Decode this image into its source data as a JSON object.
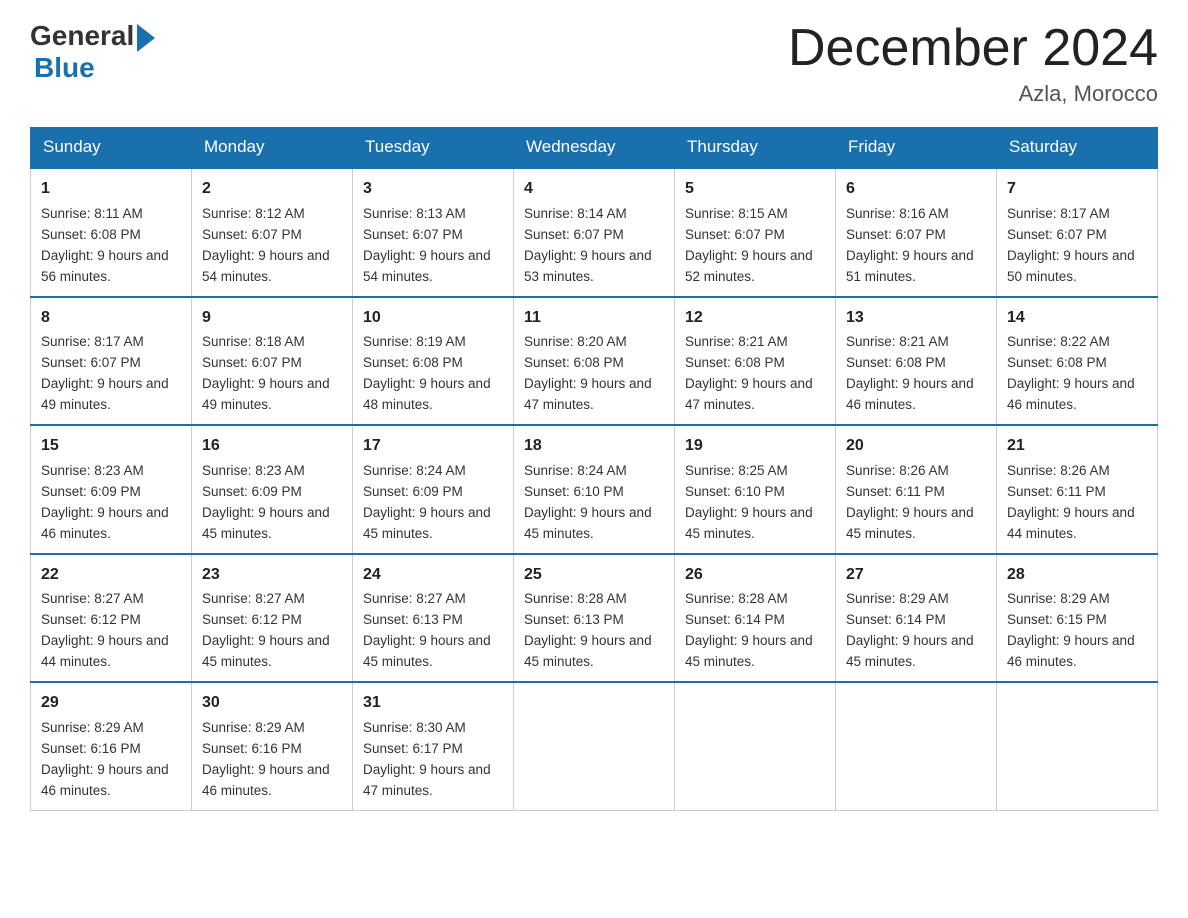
{
  "logo": {
    "general": "General",
    "blue": "Blue"
  },
  "title": "December 2024",
  "location": "Azla, Morocco",
  "days_of_week": [
    "Sunday",
    "Monday",
    "Tuesday",
    "Wednesday",
    "Thursday",
    "Friday",
    "Saturday"
  ],
  "weeks": [
    [
      {
        "day": "1",
        "sunrise": "8:11 AM",
        "sunset": "6:08 PM",
        "daylight": "9 hours and 56 minutes."
      },
      {
        "day": "2",
        "sunrise": "8:12 AM",
        "sunset": "6:07 PM",
        "daylight": "9 hours and 54 minutes."
      },
      {
        "day": "3",
        "sunrise": "8:13 AM",
        "sunset": "6:07 PM",
        "daylight": "9 hours and 54 minutes."
      },
      {
        "day": "4",
        "sunrise": "8:14 AM",
        "sunset": "6:07 PM",
        "daylight": "9 hours and 53 minutes."
      },
      {
        "day": "5",
        "sunrise": "8:15 AM",
        "sunset": "6:07 PM",
        "daylight": "9 hours and 52 minutes."
      },
      {
        "day": "6",
        "sunrise": "8:16 AM",
        "sunset": "6:07 PM",
        "daylight": "9 hours and 51 minutes."
      },
      {
        "day": "7",
        "sunrise": "8:17 AM",
        "sunset": "6:07 PM",
        "daylight": "9 hours and 50 minutes."
      }
    ],
    [
      {
        "day": "8",
        "sunrise": "8:17 AM",
        "sunset": "6:07 PM",
        "daylight": "9 hours and 49 minutes."
      },
      {
        "day": "9",
        "sunrise": "8:18 AM",
        "sunset": "6:07 PM",
        "daylight": "9 hours and 49 minutes."
      },
      {
        "day": "10",
        "sunrise": "8:19 AM",
        "sunset": "6:08 PM",
        "daylight": "9 hours and 48 minutes."
      },
      {
        "day": "11",
        "sunrise": "8:20 AM",
        "sunset": "6:08 PM",
        "daylight": "9 hours and 47 minutes."
      },
      {
        "day": "12",
        "sunrise": "8:21 AM",
        "sunset": "6:08 PM",
        "daylight": "9 hours and 47 minutes."
      },
      {
        "day": "13",
        "sunrise": "8:21 AM",
        "sunset": "6:08 PM",
        "daylight": "9 hours and 46 minutes."
      },
      {
        "day": "14",
        "sunrise": "8:22 AM",
        "sunset": "6:08 PM",
        "daylight": "9 hours and 46 minutes."
      }
    ],
    [
      {
        "day": "15",
        "sunrise": "8:23 AM",
        "sunset": "6:09 PM",
        "daylight": "9 hours and 46 minutes."
      },
      {
        "day": "16",
        "sunrise": "8:23 AM",
        "sunset": "6:09 PM",
        "daylight": "9 hours and 45 minutes."
      },
      {
        "day": "17",
        "sunrise": "8:24 AM",
        "sunset": "6:09 PM",
        "daylight": "9 hours and 45 minutes."
      },
      {
        "day": "18",
        "sunrise": "8:24 AM",
        "sunset": "6:10 PM",
        "daylight": "9 hours and 45 minutes."
      },
      {
        "day": "19",
        "sunrise": "8:25 AM",
        "sunset": "6:10 PM",
        "daylight": "9 hours and 45 minutes."
      },
      {
        "day": "20",
        "sunrise": "8:26 AM",
        "sunset": "6:11 PM",
        "daylight": "9 hours and 45 minutes."
      },
      {
        "day": "21",
        "sunrise": "8:26 AM",
        "sunset": "6:11 PM",
        "daylight": "9 hours and 44 minutes."
      }
    ],
    [
      {
        "day": "22",
        "sunrise": "8:27 AM",
        "sunset": "6:12 PM",
        "daylight": "9 hours and 44 minutes."
      },
      {
        "day": "23",
        "sunrise": "8:27 AM",
        "sunset": "6:12 PM",
        "daylight": "9 hours and 45 minutes."
      },
      {
        "day": "24",
        "sunrise": "8:27 AM",
        "sunset": "6:13 PM",
        "daylight": "9 hours and 45 minutes."
      },
      {
        "day": "25",
        "sunrise": "8:28 AM",
        "sunset": "6:13 PM",
        "daylight": "9 hours and 45 minutes."
      },
      {
        "day": "26",
        "sunrise": "8:28 AM",
        "sunset": "6:14 PM",
        "daylight": "9 hours and 45 minutes."
      },
      {
        "day": "27",
        "sunrise": "8:29 AM",
        "sunset": "6:14 PM",
        "daylight": "9 hours and 45 minutes."
      },
      {
        "day": "28",
        "sunrise": "8:29 AM",
        "sunset": "6:15 PM",
        "daylight": "9 hours and 46 minutes."
      }
    ],
    [
      {
        "day": "29",
        "sunrise": "8:29 AM",
        "sunset": "6:16 PM",
        "daylight": "9 hours and 46 minutes."
      },
      {
        "day": "30",
        "sunrise": "8:29 AM",
        "sunset": "6:16 PM",
        "daylight": "9 hours and 46 minutes."
      },
      {
        "day": "31",
        "sunrise": "8:30 AM",
        "sunset": "6:17 PM",
        "daylight": "9 hours and 47 minutes."
      },
      null,
      null,
      null,
      null
    ]
  ]
}
